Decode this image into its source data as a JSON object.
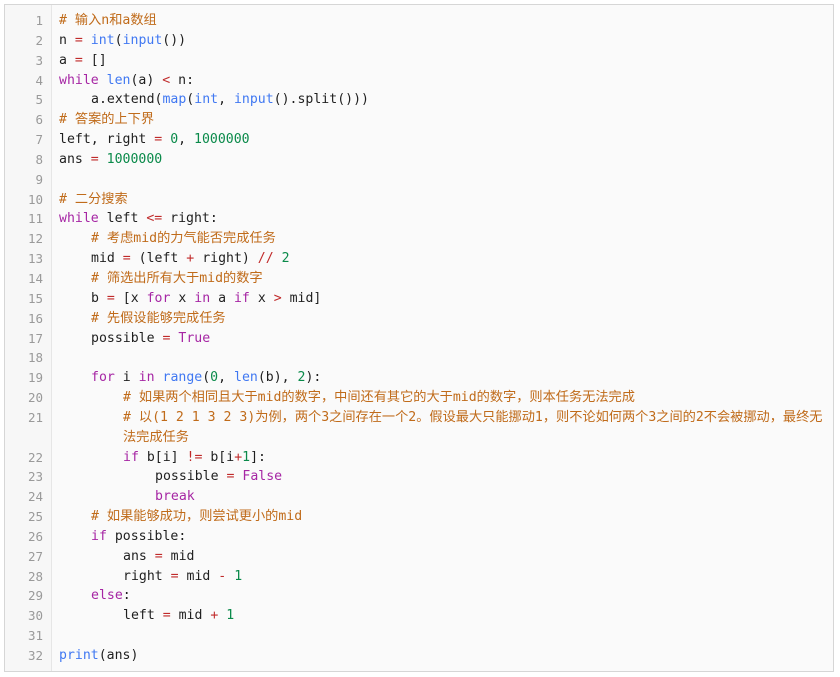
{
  "editor": {
    "lines": [
      {
        "n": "1",
        "parts": [
          [
            "cm",
            "# 输入n和a数组"
          ]
        ],
        "indent": 0
      },
      {
        "n": "2",
        "parts": [
          [
            "tx",
            "n "
          ],
          [
            "op",
            "="
          ],
          [
            "tx",
            " "
          ],
          [
            "bi",
            "int"
          ],
          [
            "tx",
            "("
          ],
          [
            "bi",
            "input"
          ],
          [
            "tx",
            "())"
          ]
        ],
        "indent": 0
      },
      {
        "n": "3",
        "parts": [
          [
            "tx",
            "a "
          ],
          [
            "op",
            "="
          ],
          [
            "tx",
            " []"
          ]
        ],
        "indent": 0
      },
      {
        "n": "4",
        "parts": [
          [
            "kw",
            "while"
          ],
          [
            "tx",
            " "
          ],
          [
            "bi",
            "len"
          ],
          [
            "tx",
            "(a) "
          ],
          [
            "op",
            "<"
          ],
          [
            "tx",
            " n:"
          ]
        ],
        "indent": 0
      },
      {
        "n": "5",
        "parts": [
          [
            "tx",
            "a.extend("
          ],
          [
            "bi",
            "map"
          ],
          [
            "tx",
            "("
          ],
          [
            "bi",
            "int"
          ],
          [
            "tx",
            ", "
          ],
          [
            "bi",
            "input"
          ],
          [
            "tx",
            "().split()))"
          ]
        ],
        "indent": 1
      },
      {
        "n": "6",
        "parts": [
          [
            "cm",
            "# 答案的上下界"
          ]
        ],
        "indent": 0
      },
      {
        "n": "7",
        "parts": [
          [
            "tx",
            "left, right "
          ],
          [
            "op",
            "="
          ],
          [
            "tx",
            " "
          ],
          [
            "num",
            "0"
          ],
          [
            "tx",
            ", "
          ],
          [
            "num",
            "1000000"
          ]
        ],
        "indent": 0
      },
      {
        "n": "8",
        "parts": [
          [
            "tx",
            "ans "
          ],
          [
            "op",
            "="
          ],
          [
            "tx",
            " "
          ],
          [
            "num",
            "1000000"
          ]
        ],
        "indent": 0
      },
      {
        "n": "9",
        "parts": [],
        "indent": 0
      },
      {
        "n": "10",
        "parts": [
          [
            "cm",
            "# 二分搜索"
          ]
        ],
        "indent": 0
      },
      {
        "n": "11",
        "parts": [
          [
            "kw",
            "while"
          ],
          [
            "tx",
            " left "
          ],
          [
            "op",
            "<="
          ],
          [
            "tx",
            " right:"
          ]
        ],
        "indent": 0
      },
      {
        "n": "12",
        "parts": [
          [
            "cm",
            "# 考虑mid的力气能否完成任务"
          ]
        ],
        "indent": 1
      },
      {
        "n": "13",
        "parts": [
          [
            "tx",
            "mid "
          ],
          [
            "op",
            "="
          ],
          [
            "tx",
            " (left "
          ],
          [
            "op",
            "+"
          ],
          [
            "tx",
            " right) "
          ],
          [
            "op",
            "//"
          ],
          [
            "tx",
            " "
          ],
          [
            "num",
            "2"
          ]
        ],
        "indent": 1
      },
      {
        "n": "14",
        "parts": [
          [
            "cm",
            "# 筛选出所有大于mid的数字"
          ]
        ],
        "indent": 1
      },
      {
        "n": "15",
        "parts": [
          [
            "tx",
            "b "
          ],
          [
            "op",
            "="
          ],
          [
            "tx",
            " [x "
          ],
          [
            "kw",
            "for"
          ],
          [
            "tx",
            " x "
          ],
          [
            "kw",
            "in"
          ],
          [
            "tx",
            " a "
          ],
          [
            "kw",
            "if"
          ],
          [
            "tx",
            " x "
          ],
          [
            "op",
            ">"
          ],
          [
            "tx",
            " mid]"
          ]
        ],
        "indent": 1
      },
      {
        "n": "16",
        "parts": [
          [
            "cm",
            "# 先假设能够完成任务"
          ]
        ],
        "indent": 1
      },
      {
        "n": "17",
        "parts": [
          [
            "tx",
            "possible "
          ],
          [
            "op",
            "="
          ],
          [
            "tx",
            " "
          ],
          [
            "kw",
            "True"
          ]
        ],
        "indent": 1
      },
      {
        "n": "18",
        "parts": [],
        "indent": 0
      },
      {
        "n": "19",
        "parts": [
          [
            "kw",
            "for"
          ],
          [
            "tx",
            " i "
          ],
          [
            "kw",
            "in"
          ],
          [
            "tx",
            " "
          ],
          [
            "bi",
            "range"
          ],
          [
            "tx",
            "("
          ],
          [
            "num",
            "0"
          ],
          [
            "tx",
            ", "
          ],
          [
            "bi",
            "len"
          ],
          [
            "tx",
            "(b), "
          ],
          [
            "num",
            "2"
          ],
          [
            "tx",
            "):"
          ]
        ],
        "indent": 1
      },
      {
        "n": "20",
        "parts": [
          [
            "cm",
            "# 如果两个相同且大于mid的数字，中间还有其它的大于mid的数字，则本任务无法完成"
          ]
        ],
        "indent": 2
      },
      {
        "n": "21",
        "parts": [
          [
            "cm",
            "# 以(1 2 1 3 2 3)为例，两个3之间存在一个2。假设最大只能挪动1，则不论如何两个3之间的2不会被挪动，最终无法完成任务"
          ]
        ],
        "indent": 2,
        "wrap": true
      },
      {
        "n": "22",
        "parts": [
          [
            "kw",
            "if"
          ],
          [
            "tx",
            " b[i] "
          ],
          [
            "op",
            "!="
          ],
          [
            "tx",
            " b[i"
          ],
          [
            "op",
            "+"
          ],
          [
            "num",
            "1"
          ],
          [
            "tx",
            "]:"
          ]
        ],
        "indent": 2
      },
      {
        "n": "23",
        "parts": [
          [
            "tx",
            "possible "
          ],
          [
            "op",
            "="
          ],
          [
            "tx",
            " "
          ],
          [
            "kw",
            "False"
          ]
        ],
        "indent": 3
      },
      {
        "n": "24",
        "parts": [
          [
            "kw",
            "break"
          ]
        ],
        "indent": 3
      },
      {
        "n": "25",
        "parts": [
          [
            "cm",
            "# 如果能够成功，则尝试更小的mid"
          ]
        ],
        "indent": 1
      },
      {
        "n": "26",
        "parts": [
          [
            "kw",
            "if"
          ],
          [
            "tx",
            " possible:"
          ]
        ],
        "indent": 1
      },
      {
        "n": "27",
        "parts": [
          [
            "tx",
            "ans "
          ],
          [
            "op",
            "="
          ],
          [
            "tx",
            " mid"
          ]
        ],
        "indent": 2
      },
      {
        "n": "28",
        "parts": [
          [
            "tx",
            "right "
          ],
          [
            "op",
            "="
          ],
          [
            "tx",
            " mid "
          ],
          [
            "op",
            "-"
          ],
          [
            "tx",
            " "
          ],
          [
            "num",
            "1"
          ]
        ],
        "indent": 2
      },
      {
        "n": "29",
        "parts": [
          [
            "kw",
            "else"
          ],
          [
            "tx",
            ":"
          ]
        ],
        "indent": 1
      },
      {
        "n": "30",
        "parts": [
          [
            "tx",
            "left "
          ],
          [
            "op",
            "="
          ],
          [
            "tx",
            " mid "
          ],
          [
            "op",
            "+"
          ],
          [
            "tx",
            " "
          ],
          [
            "num",
            "1"
          ]
        ],
        "indent": 2
      },
      {
        "n": "31",
        "parts": [],
        "indent": 0
      },
      {
        "n": "32",
        "parts": [
          [
            "bi",
            "print"
          ],
          [
            "tx",
            "(ans)"
          ]
        ],
        "indent": 0
      }
    ]
  },
  "colors": {
    "keyword": "#a626a4",
    "builtin": "#4078f2",
    "number": "#0a8a4a",
    "operator": "#c02a2a",
    "comment": "#c06b1a"
  }
}
